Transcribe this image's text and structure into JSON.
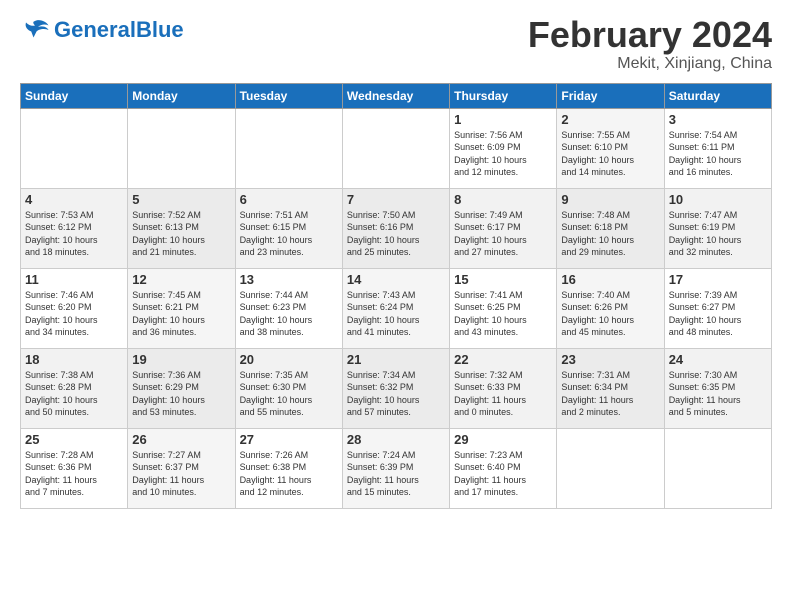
{
  "header": {
    "logo_text_general": "General",
    "logo_text_blue": "Blue",
    "month": "February 2024",
    "location": "Mekit, Xinjiang, China"
  },
  "weekdays": [
    "Sunday",
    "Monday",
    "Tuesday",
    "Wednesday",
    "Thursday",
    "Friday",
    "Saturday"
  ],
  "weeks": [
    [
      {
        "day": "",
        "info": ""
      },
      {
        "day": "",
        "info": ""
      },
      {
        "day": "",
        "info": ""
      },
      {
        "day": "",
        "info": ""
      },
      {
        "day": "1",
        "info": "Sunrise: 7:56 AM\nSunset: 6:09 PM\nDaylight: 10 hours\nand 12 minutes."
      },
      {
        "day": "2",
        "info": "Sunrise: 7:55 AM\nSunset: 6:10 PM\nDaylight: 10 hours\nand 14 minutes."
      },
      {
        "day": "3",
        "info": "Sunrise: 7:54 AM\nSunset: 6:11 PM\nDaylight: 10 hours\nand 16 minutes."
      }
    ],
    [
      {
        "day": "4",
        "info": "Sunrise: 7:53 AM\nSunset: 6:12 PM\nDaylight: 10 hours\nand 18 minutes."
      },
      {
        "day": "5",
        "info": "Sunrise: 7:52 AM\nSunset: 6:13 PM\nDaylight: 10 hours\nand 21 minutes."
      },
      {
        "day": "6",
        "info": "Sunrise: 7:51 AM\nSunset: 6:15 PM\nDaylight: 10 hours\nand 23 minutes."
      },
      {
        "day": "7",
        "info": "Sunrise: 7:50 AM\nSunset: 6:16 PM\nDaylight: 10 hours\nand 25 minutes."
      },
      {
        "day": "8",
        "info": "Sunrise: 7:49 AM\nSunset: 6:17 PM\nDaylight: 10 hours\nand 27 minutes."
      },
      {
        "day": "9",
        "info": "Sunrise: 7:48 AM\nSunset: 6:18 PM\nDaylight: 10 hours\nand 29 minutes."
      },
      {
        "day": "10",
        "info": "Sunrise: 7:47 AM\nSunset: 6:19 PM\nDaylight: 10 hours\nand 32 minutes."
      }
    ],
    [
      {
        "day": "11",
        "info": "Sunrise: 7:46 AM\nSunset: 6:20 PM\nDaylight: 10 hours\nand 34 minutes."
      },
      {
        "day": "12",
        "info": "Sunrise: 7:45 AM\nSunset: 6:21 PM\nDaylight: 10 hours\nand 36 minutes."
      },
      {
        "day": "13",
        "info": "Sunrise: 7:44 AM\nSunset: 6:23 PM\nDaylight: 10 hours\nand 38 minutes."
      },
      {
        "day": "14",
        "info": "Sunrise: 7:43 AM\nSunset: 6:24 PM\nDaylight: 10 hours\nand 41 minutes."
      },
      {
        "day": "15",
        "info": "Sunrise: 7:41 AM\nSunset: 6:25 PM\nDaylight: 10 hours\nand 43 minutes."
      },
      {
        "day": "16",
        "info": "Sunrise: 7:40 AM\nSunset: 6:26 PM\nDaylight: 10 hours\nand 45 minutes."
      },
      {
        "day": "17",
        "info": "Sunrise: 7:39 AM\nSunset: 6:27 PM\nDaylight: 10 hours\nand 48 minutes."
      }
    ],
    [
      {
        "day": "18",
        "info": "Sunrise: 7:38 AM\nSunset: 6:28 PM\nDaylight: 10 hours\nand 50 minutes."
      },
      {
        "day": "19",
        "info": "Sunrise: 7:36 AM\nSunset: 6:29 PM\nDaylight: 10 hours\nand 53 minutes."
      },
      {
        "day": "20",
        "info": "Sunrise: 7:35 AM\nSunset: 6:30 PM\nDaylight: 10 hours\nand 55 minutes."
      },
      {
        "day": "21",
        "info": "Sunrise: 7:34 AM\nSunset: 6:32 PM\nDaylight: 10 hours\nand 57 minutes."
      },
      {
        "day": "22",
        "info": "Sunrise: 7:32 AM\nSunset: 6:33 PM\nDaylight: 11 hours\nand 0 minutes."
      },
      {
        "day": "23",
        "info": "Sunrise: 7:31 AM\nSunset: 6:34 PM\nDaylight: 11 hours\nand 2 minutes."
      },
      {
        "day": "24",
        "info": "Sunrise: 7:30 AM\nSunset: 6:35 PM\nDaylight: 11 hours\nand 5 minutes."
      }
    ],
    [
      {
        "day": "25",
        "info": "Sunrise: 7:28 AM\nSunset: 6:36 PM\nDaylight: 11 hours\nand 7 minutes."
      },
      {
        "day": "26",
        "info": "Sunrise: 7:27 AM\nSunset: 6:37 PM\nDaylight: 11 hours\nand 10 minutes."
      },
      {
        "day": "27",
        "info": "Sunrise: 7:26 AM\nSunset: 6:38 PM\nDaylight: 11 hours\nand 12 minutes."
      },
      {
        "day": "28",
        "info": "Sunrise: 7:24 AM\nSunset: 6:39 PM\nDaylight: 11 hours\nand 15 minutes."
      },
      {
        "day": "29",
        "info": "Sunrise: 7:23 AM\nSunset: 6:40 PM\nDaylight: 11 hours\nand 17 minutes."
      },
      {
        "day": "",
        "info": ""
      },
      {
        "day": "",
        "info": ""
      }
    ]
  ]
}
